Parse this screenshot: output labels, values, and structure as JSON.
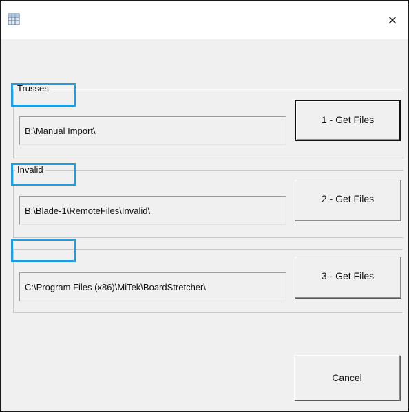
{
  "window": {
    "close_glyph": "×"
  },
  "groups": [
    {
      "label": "Trusses",
      "path": "B:\\Manual Import\\",
      "button": "1 - Get Files"
    },
    {
      "label": "Invalid",
      "path": "B:\\Blade-1\\RemoteFiles\\Invalid\\",
      "button": "2 - Get Files"
    },
    {
      "label": "",
      "path": "C:\\Program Files (x86)\\MiTek\\BoardStretcher\\",
      "button": "3 - Get Files"
    }
  ],
  "footer": {
    "cancel_label": "Cancel"
  },
  "colors": {
    "highlight": "#1e9de3",
    "background": "#f0f0f0"
  },
  "icons": {
    "app": "grid-window-icon",
    "close": "close-icon"
  }
}
